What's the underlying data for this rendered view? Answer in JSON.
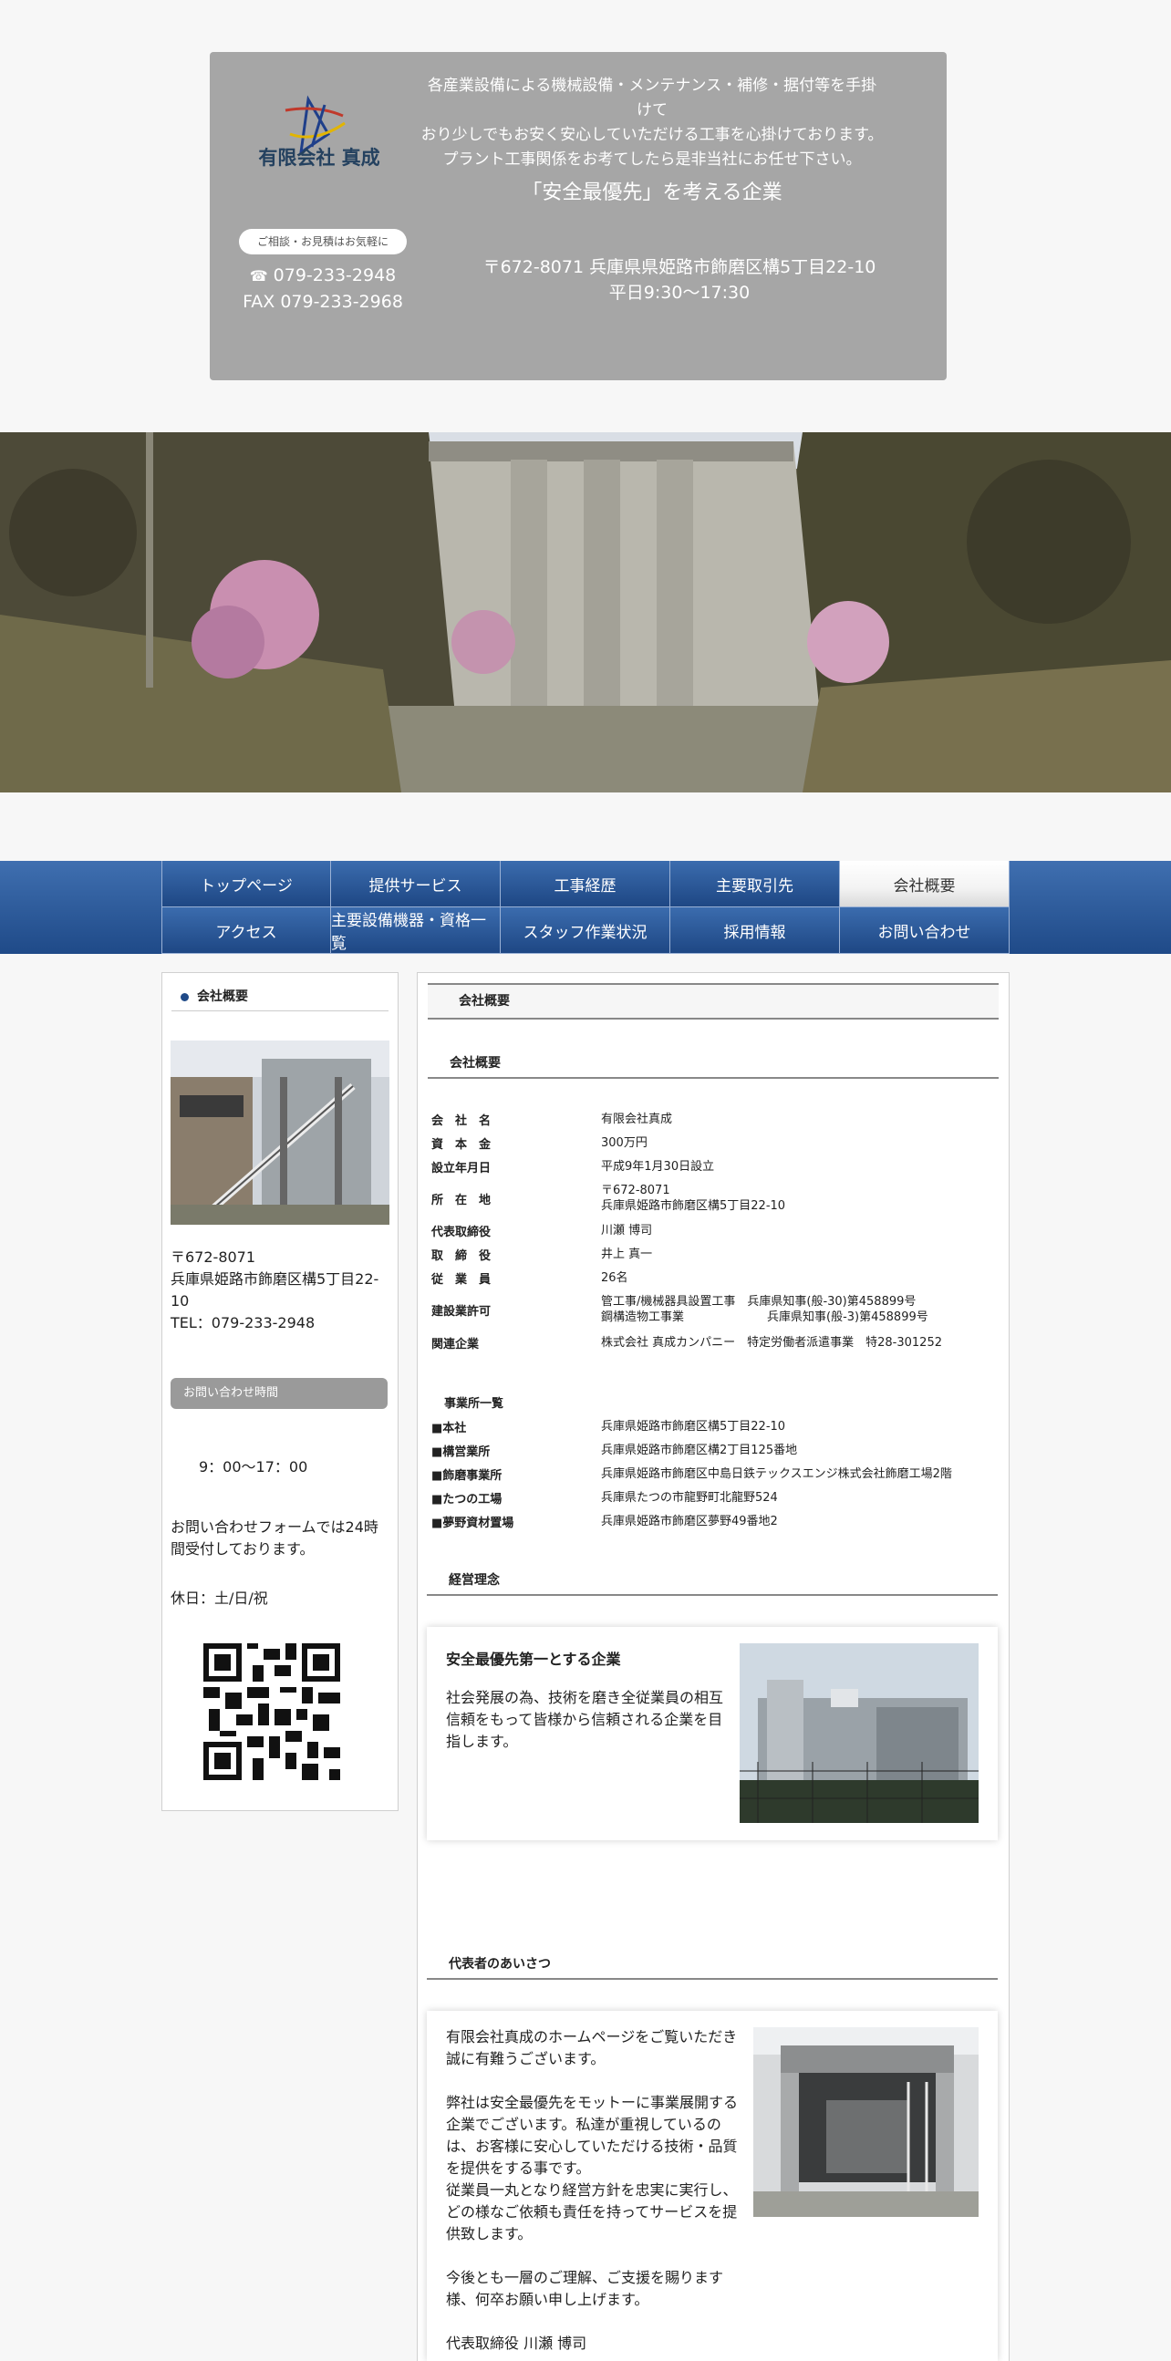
{
  "header": {
    "logo_text": "有限会社 真成",
    "intro_lines": [
      "各産業設備による機械設備・メンテナンス・補修・据付等を手掛",
      "けて",
      "おり少しでもお安く安心していただける工事を心掛けております。",
      "プラント工事関係をお考てしたら是非当社にお任せ下さい。"
    ],
    "tagline": "「安全最優先」を考える企業",
    "consult_label": "ご相談・お見積はお気軽に",
    "tel": "079-233-2948",
    "fax": "FAX 079-233-2968",
    "address": "〒672-8071  兵庫県県姫路市飾磨区構5丁目22-10",
    "hours": "平日9:30〜17:30"
  },
  "nav": {
    "items": [
      {
        "label": "トップページ"
      },
      {
        "label": "提供サービス"
      },
      {
        "label": "工事経歴"
      },
      {
        "label": "主要取引先"
      },
      {
        "label": "会社概要"
      },
      {
        "label": "アクセス"
      },
      {
        "label": "主要設備機器・資格一覧"
      },
      {
        "label": "スタッフ作業状況"
      },
      {
        "label": "採用情報"
      },
      {
        "label": "お問い合わせ"
      }
    ]
  },
  "sidebar": {
    "title": "会社概要",
    "addr_lines": [
      "〒672-8071",
      "兵庫県姫路市飾磨区構5丁目22-",
      "10",
      "TEL：079-233-2948"
    ],
    "hours_button": "お問い合わせ時間",
    "hours": "9：00〜17：00",
    "note_lines": [
      "お問い合わせフォームでは24時",
      "間受付しております。"
    ],
    "holiday": "休日：土/日/祝"
  },
  "main": {
    "page_title": "会社概要",
    "section_company": "会社概要",
    "company_rows": [
      {
        "k": "会　社　名",
        "v": [
          "有限会社真成"
        ]
      },
      {
        "k": "資　本　金",
        "v": [
          "300万円"
        ]
      },
      {
        "k": "設立年月日",
        "v": [
          "平成9年1月30日設立"
        ]
      },
      {
        "k": "所　在　地",
        "v": [
          "〒672-8071",
          "兵庫県姫路市飾磨区構5丁目22-10"
        ]
      },
      {
        "k": "代表取締役",
        "v": [
          "川瀬 博司"
        ]
      },
      {
        "k": "取　締　役",
        "v": [
          "井上 真一"
        ]
      },
      {
        "k": "従　業　員",
        "v": [
          " 26名"
        ]
      },
      {
        "k": "建設業許可",
        "v": [
          "管工事/機械器具設置工事　兵庫県知事(般-30)第458899号",
          "鋼構造物工事業　　　　　　　兵庫県知事(般-3)第458899号"
        ]
      },
      {
        "k": "関連企業",
        "v": [
          "株式会社 真成カンパニー　特定労働者派遣事業　特28-301252"
        ]
      }
    ],
    "offices_head": "事業所一覧",
    "office_rows": [
      {
        "k": "■本社",
        "v": [
          "兵庫県姫路市飾磨区構5丁目22-10"
        ]
      },
      {
        "k": "■構営業所",
        "v": [
          "兵庫県姫路市飾磨区構2丁目125番地"
        ]
      },
      {
        "k": "■飾磨事業所",
        "v": [
          "兵庫県姫路市飾磨区中島日鉄テックスエンジ株式会社飾磨工場2階"
        ]
      },
      {
        "k": "■たつの工場",
        "v": [
          "兵庫県たつの市龍野町北龍野524"
        ]
      },
      {
        "k": "■夢野資材置場",
        "v": [
          "兵庫県姫路市飾磨区夢野49番地2"
        ]
      }
    ],
    "section_philosophy": "経営理念",
    "philosophy_head": "安全最優先第一とする企業",
    "philosophy_lines": [
      "社会発展の為、技術を磨き全従業員の相互",
      "信頼をもって皆様から信頼される企業を目",
      "指します。"
    ],
    "section_greeting": "代表者のあいさつ",
    "greeting_lines": [
      "有限会社真成のホームページをご覧いただき",
      "誠に有難うございます。",
      "",
      "弊社は安全最優先をモットーに事業展開する",
      "企業でございます。私達が重視しているの",
      "は、お客様に安心していただける技術・品質",
      "を提供をする事です。",
      "従業員一丸となり経営方針を忠実に実行し、",
      "どの様なご依頼も責任を持ってサービスを提",
      "供致します。",
      "",
      "今後とも一層のご理解、ご支援を賜ります",
      "様、何卒お願い申し上げます。",
      "",
      "代表取締役  川瀬 博司"
    ]
  },
  "colors": {
    "nav": "#2a5799",
    "header_bg": "#a6a6a6",
    "active_tab": "#f0f0f0"
  }
}
